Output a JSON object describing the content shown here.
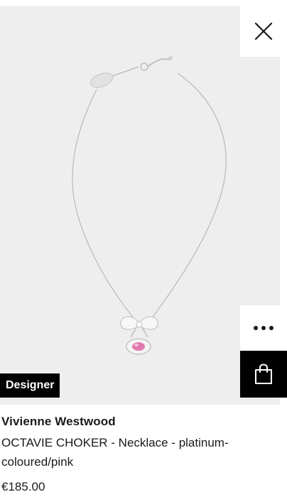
{
  "product": {
    "badge": "Designer",
    "brand": "Vivienne Westwood",
    "title": "OCTAVIE CHOKER - Necklace - platinum-coloured/pink",
    "price": "€185.00"
  },
  "actions": {
    "close_icon": "close-icon",
    "more_icon": "more-options-icon",
    "bag_icon": "shopping-bag-icon"
  },
  "colors": {
    "image_background": "#eeeeee",
    "badge_background": "#000000",
    "bag_button_background": "#000000",
    "accent_stone": "#e07ab0"
  }
}
